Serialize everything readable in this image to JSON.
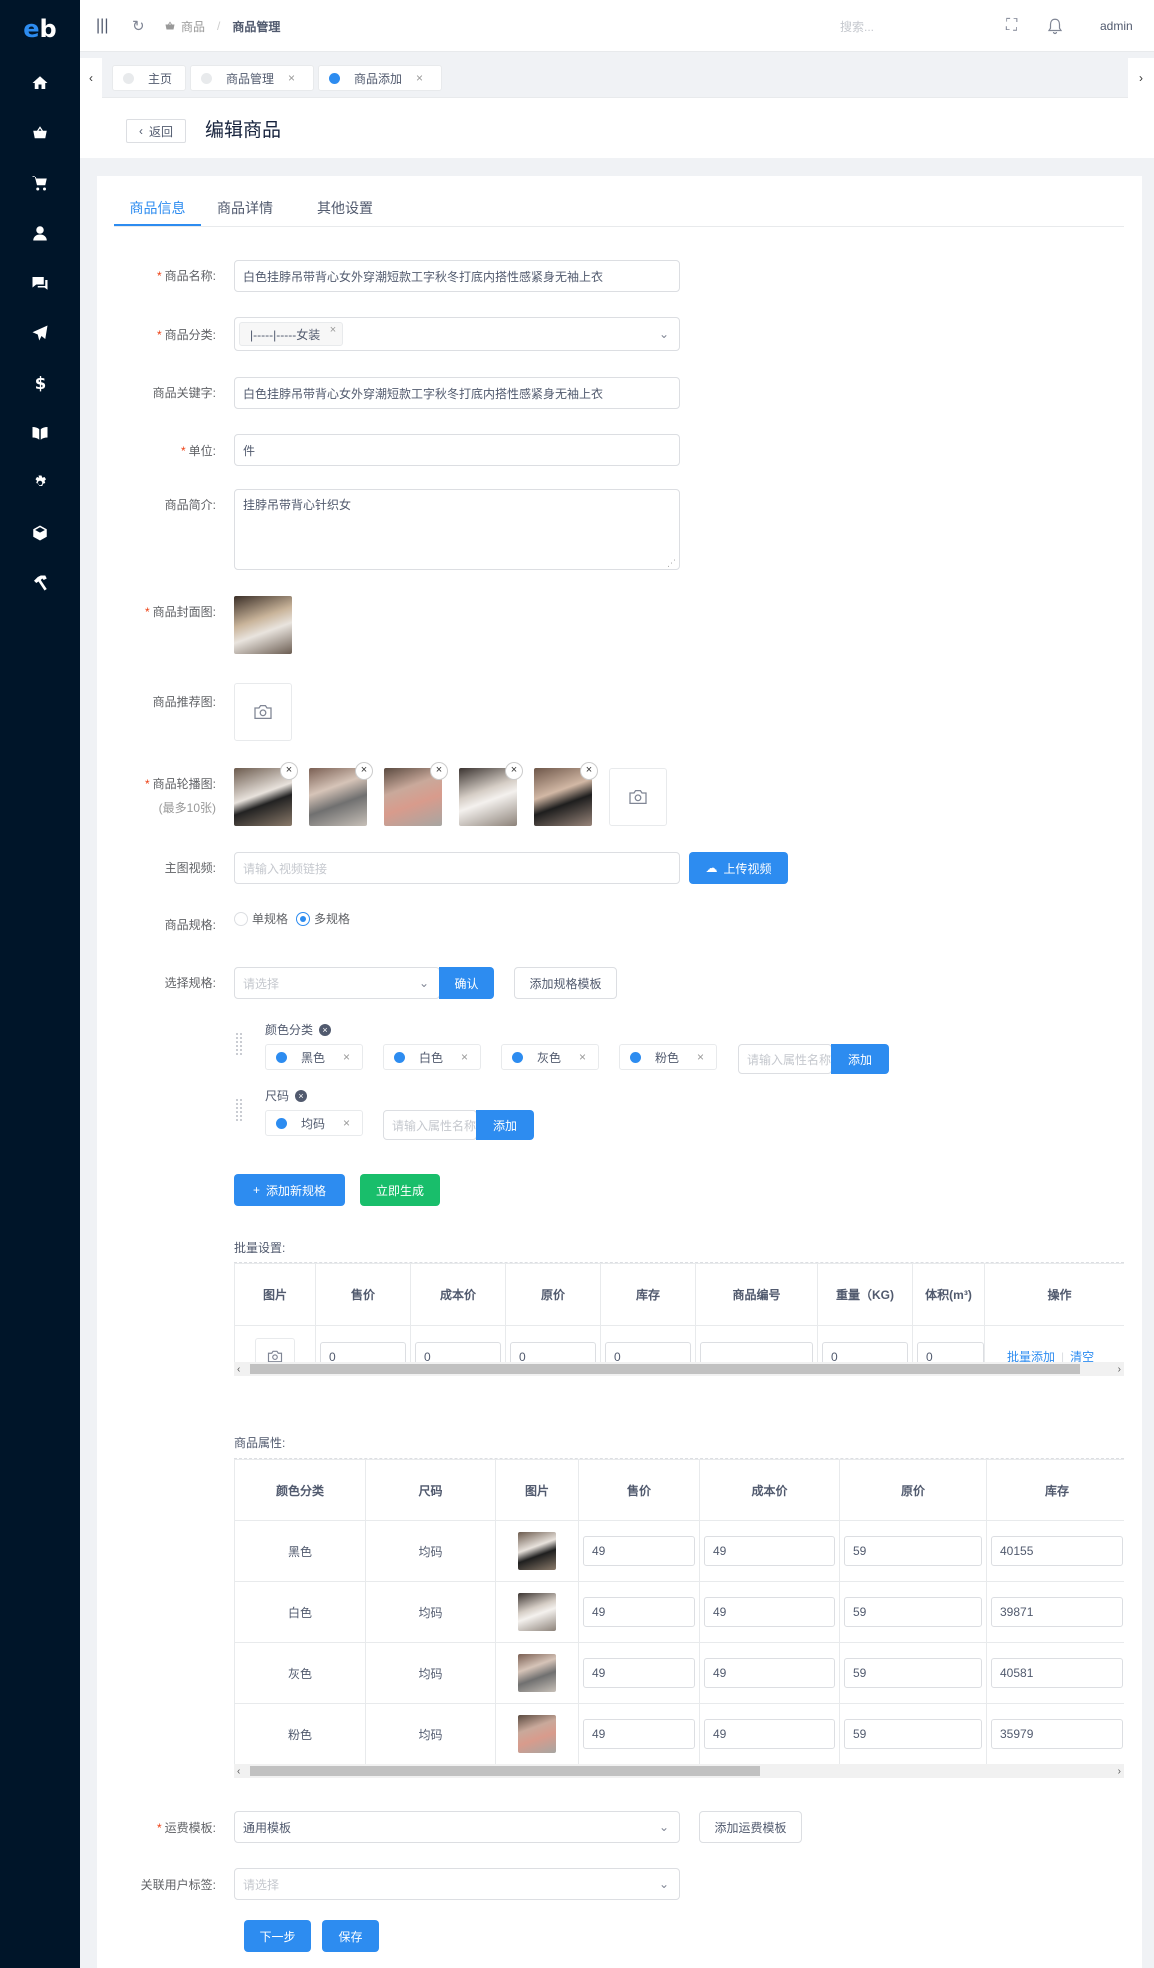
{
  "app": {
    "logo_e": "e",
    "logo_b": "b"
  },
  "topbar": {
    "breadcrumb_root": "商品",
    "breadcrumb_sep": "/",
    "breadcrumb_current": "商品管理",
    "search_placeholder": "搜索...",
    "user": "admin"
  },
  "sidebar": {
    "icons": [
      "home-icon",
      "basket-icon",
      "cart-icon",
      "user-icon",
      "chat-icon",
      "send-icon",
      "dollar-icon",
      "book-icon",
      "gear-icon",
      "cube-icon",
      "hammer-icon"
    ]
  },
  "tabs": [
    {
      "label": "主页"
    },
    {
      "label": "商品管理",
      "close": "×"
    },
    {
      "label": "商品添加",
      "close": "×"
    }
  ],
  "header": {
    "back": "返回",
    "title": "编辑商品"
  },
  "form_tabs": [
    "商品信息",
    "商品详情",
    "其他设置"
  ],
  "form": {
    "name_label": "商品名称:",
    "name_value": "白色挂脖吊带背心女外穿潮短款工字秋冬打底内搭性感紧身无袖上衣",
    "category_label": "商品分类:",
    "category_tag": "|-----|-----女装",
    "keyword_label": "商品关键字:",
    "keyword_value": "白色挂脖吊带背心女外穿潮短款工字秋冬打底内搭性感紧身无袖上衣",
    "unit_label": "单位:",
    "unit_value": "件",
    "intro_label": "商品简介:",
    "intro_value": "挂脖吊带背心针织女",
    "cover_label": "商品封面图:",
    "recommend_label": "商品推荐图:",
    "carousel_label": "商品轮播图:",
    "carousel_hint": "(最多10张)",
    "video_label": "主图视频:",
    "video_placeholder": "请输入视频链接",
    "video_button": "上传视频",
    "spec_label": "商品规格:",
    "spec_single": "单规格",
    "spec_multi": "多规格",
    "select_spec_label": "选择规格:",
    "select_placeholder": "请选择",
    "confirm_button": "确认",
    "add_template_button": "添加规格模板",
    "attr_name_placeholder": "请输入属性名称",
    "add_button": "添加",
    "add_new_spec_button": "添加新规格",
    "generate_button": "立即生成",
    "batch_label": "批量设置:",
    "attr_label": "商品属性:",
    "shipping_label": "运费模板:",
    "shipping_value": "通用模板",
    "add_shipping_button": "添加运费模板",
    "user_tag_label": "关联用户标签:",
    "user_tag_placeholder": "请选择",
    "next_button": "下一步",
    "save_button": "保存"
  },
  "spec_groups": [
    {
      "name": "颜色分类",
      "values": [
        "黑色",
        "白色",
        "灰色",
        "粉色"
      ]
    },
    {
      "name": "尺码",
      "values": [
        "均码"
      ]
    }
  ],
  "batch_table": {
    "headers": [
      "图片",
      "售价",
      "成本价",
      "原价",
      "库存",
      "商品编号",
      "重量（KG)",
      "体积(m³)",
      "操作"
    ],
    "values": [
      "0",
      "0",
      "0",
      "0",
      "",
      "0",
      "0"
    ],
    "action_batch": "批量添加",
    "action_clear": "清空"
  },
  "attr_table": {
    "headers": [
      "颜色分类",
      "尺码",
      "图片",
      "售价",
      "成本价",
      "原价",
      "库存"
    ],
    "rows": [
      {
        "color": "黑色",
        "size": "均码",
        "price": "49",
        "cost": "49",
        "original": "59",
        "stock": "40155"
      },
      {
        "color": "白色",
        "size": "均码",
        "price": "49",
        "cost": "49",
        "original": "59",
        "stock": "39871"
      },
      {
        "color": "灰色",
        "size": "均码",
        "price": "49",
        "cost": "49",
        "original": "59",
        "stock": "40581"
      },
      {
        "color": "粉色",
        "size": "均码",
        "price": "49",
        "cost": "49",
        "original": "59",
        "stock": "35979"
      }
    ]
  }
}
